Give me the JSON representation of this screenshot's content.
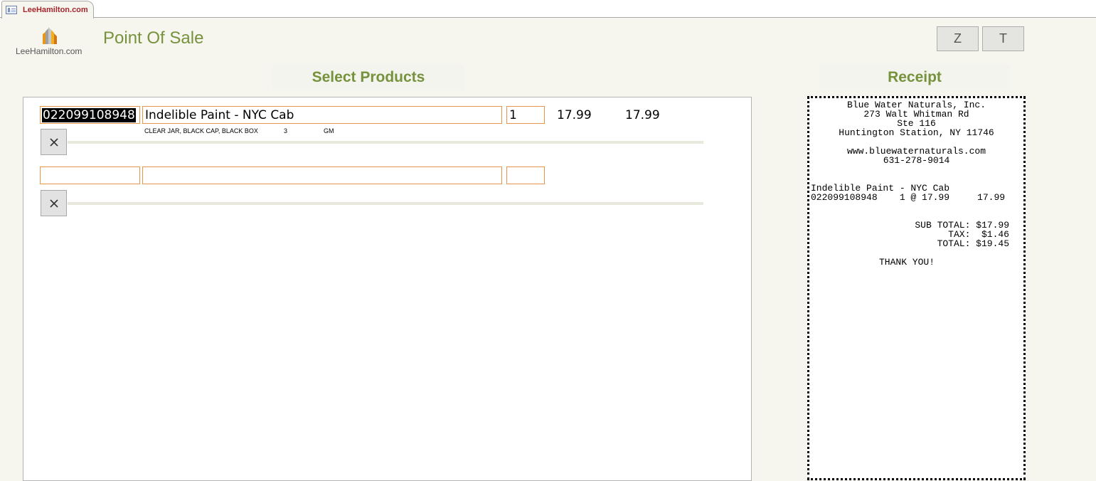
{
  "tab": {
    "label": "LeeHamilton.com"
  },
  "header": {
    "logo_text": "LeeHamilton.com",
    "title": "Point Of Sale",
    "button_z": "Z",
    "button_t": "T"
  },
  "sections": {
    "products": "Select Products",
    "receipt": "Receipt"
  },
  "lines": [
    {
      "code": "022099108948",
      "description": "Indelible Paint - NYC Cab",
      "qty": "1",
      "unit_price": "17.99",
      "line_total": "17.99",
      "details": "CLEAR JAR, BLACK CAP, BLACK BOX",
      "size": "3",
      "unit": "GM"
    },
    {
      "code": "",
      "description": "",
      "qty": "",
      "unit_price": "",
      "line_total": "",
      "details": "",
      "size": "",
      "unit": ""
    }
  ],
  "receipt": {
    "store_name": "Blue Water Naturals, Inc.",
    "address1": "273 Walt Whitman Rd",
    "address2": "Ste 116",
    "city": "Huntington Station, NY 11746",
    "website": "www.bluewaternaturals.com",
    "phone": "631-278-9014",
    "item_name": "Indelible Paint - NYC Cab",
    "item_line": "022099108948    1 @ 17.99     17.99",
    "subtotal": "SUB TOTAL: $17.99",
    "tax": "TAX:  $1.46",
    "total": "TOTAL: $19.45",
    "thanks": "THANK YOU!"
  },
  "colors": {
    "accent_green": "#76923c",
    "field_border": "#e8944a",
    "tab_text": "#a4262c"
  },
  "icons": {
    "delete": "x-icon",
    "form": "form-icon",
    "logo": "building-logo-icon"
  }
}
